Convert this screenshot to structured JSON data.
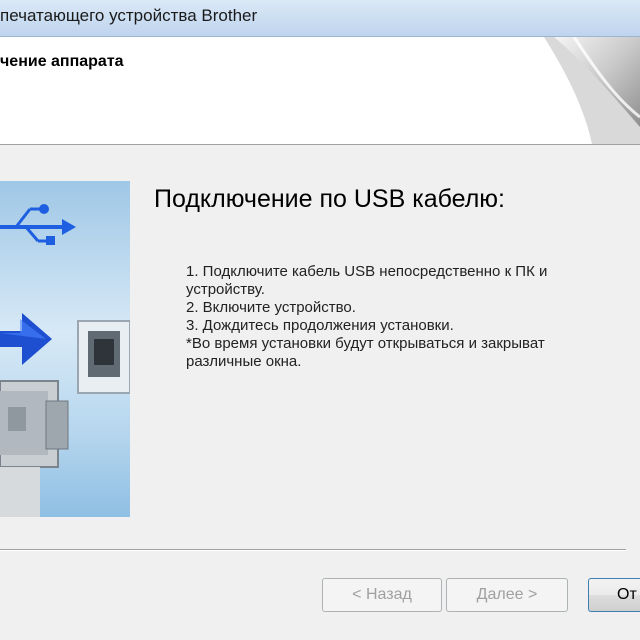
{
  "window": {
    "title": "печатающего устройства Brother"
  },
  "header": {
    "title": "чение аппарата"
  },
  "main": {
    "heading": "Подключение по USB кабелю:",
    "instructions": [
      "1. Подключите кабель USB непосредственно к ПК и",
      "устройству.",
      "2. Включите устройство.",
      "3. Дождитесь продолжения установки.",
      " *Во время установки будут открываться и закрыват",
      "различные окна."
    ]
  },
  "buttons": {
    "back": "< Назад",
    "next": "Далее >",
    "cancel": "От"
  },
  "colors": {
    "usb_arrow": "#1d5fe0",
    "title_bar": "#c9dcf1"
  },
  "icons": {
    "usb": "usb-symbol-icon",
    "arrow": "right-arrow-icon",
    "port": "usb-port-icon",
    "plug": "usb-plug-icon"
  }
}
